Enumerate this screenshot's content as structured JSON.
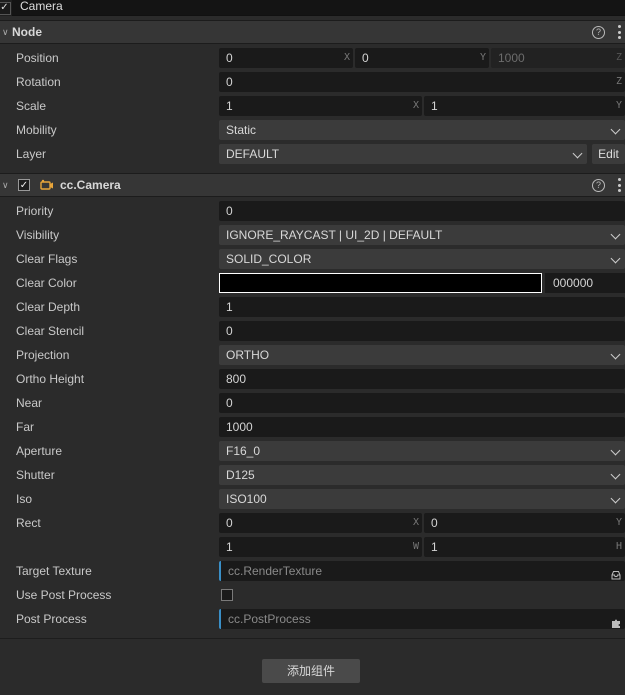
{
  "node_name": "Camera",
  "node_section": {
    "title": "Node",
    "position": {
      "label": "Position",
      "x": "0",
      "y": "0",
      "z": "1000",
      "x_axis": "X",
      "y_axis": "Y",
      "z_axis": "Z"
    },
    "rotation": {
      "label": "Rotation",
      "value": "0",
      "axis": "Z"
    },
    "scale": {
      "label": "Scale",
      "x": "1",
      "y": "1",
      "x_axis": "X",
      "y_axis": "Y"
    },
    "mobility": {
      "label": "Mobility",
      "value": "Static"
    },
    "layer": {
      "label": "Layer",
      "value": "DEFAULT",
      "edit_label": "Edit"
    }
  },
  "camera_section": {
    "title": "cc.Camera",
    "priority": {
      "label": "Priority",
      "value": "0"
    },
    "visibility": {
      "label": "Visibility",
      "value": "IGNORE_RAYCAST | UI_2D | DEFAULT"
    },
    "clear_flags": {
      "label": "Clear Flags",
      "value": "SOLID_COLOR"
    },
    "clear_color": {
      "label": "Clear Color",
      "hex": "000000",
      "swatch": "#000000"
    },
    "clear_depth": {
      "label": "Clear Depth",
      "value": "1"
    },
    "clear_stencil": {
      "label": "Clear Stencil",
      "value": "0"
    },
    "projection": {
      "label": "Projection",
      "value": "ORTHO"
    },
    "ortho_height": {
      "label": "Ortho Height",
      "value": "800"
    },
    "near": {
      "label": "Near",
      "value": "0"
    },
    "far": {
      "label": "Far",
      "value": "1000"
    },
    "aperture": {
      "label": "Aperture",
      "value": "F16_0"
    },
    "shutter": {
      "label": "Shutter",
      "value": "D125"
    },
    "iso": {
      "label": "Iso",
      "value": "ISO100"
    },
    "rect": {
      "label": "Rect",
      "x": "0",
      "y": "0",
      "w": "1",
      "h": "1",
      "x_axis": "X",
      "y_axis": "Y",
      "w_axis": "W",
      "h_axis": "H"
    },
    "target_texture": {
      "label": "Target Texture",
      "value": "cc.RenderTexture"
    },
    "use_post_process": {
      "label": "Use Post Process"
    },
    "post_process": {
      "label": "Post Process",
      "value": "cc.PostProcess"
    }
  },
  "add_component_label": "添加组件",
  "colors": {
    "accent": "#3a8fc7",
    "panel": "#2b2b2b",
    "header": "#363636",
    "field": "#1a1a1a"
  },
  "icons": [
    "check-icon",
    "chevron-down-icon",
    "help-icon",
    "more-icon",
    "camera-icon",
    "inbox-icon",
    "puzzle-icon"
  ]
}
